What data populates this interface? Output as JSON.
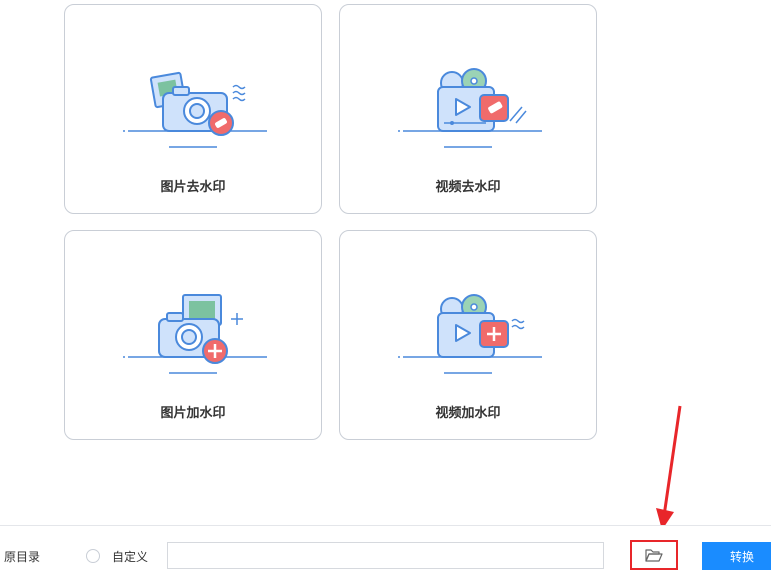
{
  "cards": [
    {
      "title": "图片去水印",
      "icon": "photo-camera-eraser-icon"
    },
    {
      "title": "视频去水印",
      "icon": "video-eraser-icon"
    },
    {
      "title": "图片加水印",
      "icon": "photo-camera-add-icon"
    },
    {
      "title": "视频加水印",
      "icon": "video-add-icon"
    }
  ],
  "output": {
    "original_dir_label": "原目录",
    "custom_label": "自定义",
    "path_value": "",
    "folder_icon": "folder-open-icon",
    "convert_label": "转换"
  },
  "annotation": {
    "arrow_icon": "red-arrow-icon"
  },
  "colors": {
    "accent": "#1a8cff",
    "icon_stroke": "#4a89dc",
    "icon_fill": "#cfe2fb",
    "badge_red": "#f06b6b",
    "highlight_red": "#e8262a"
  }
}
